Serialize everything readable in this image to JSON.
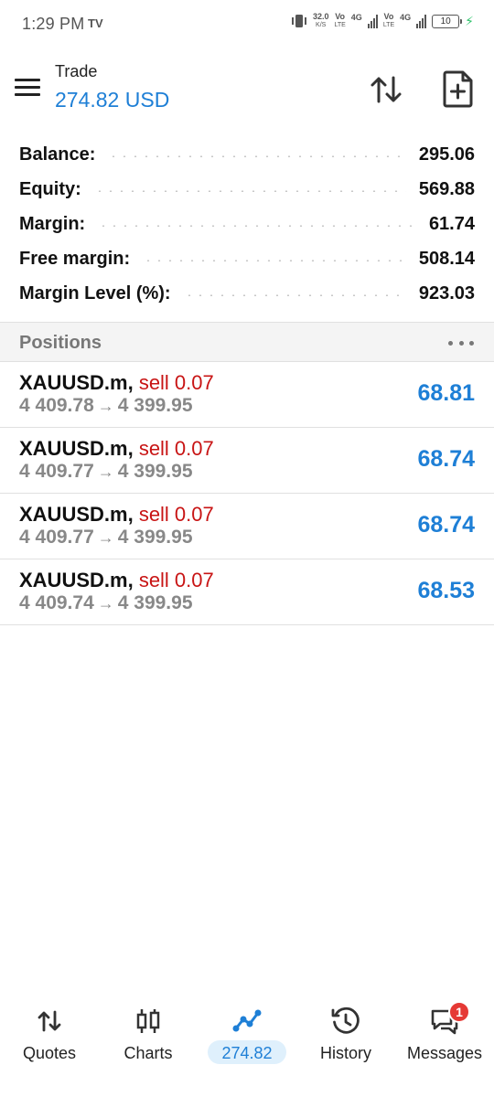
{
  "status_bar": {
    "time": "1:29 PM",
    "app_icon": "TV",
    "data_speed": "32.0",
    "data_speed_unit": "K/S",
    "sim1_label": "Vo",
    "sim1_sub": "LTE",
    "sim1_net": "4G",
    "sim2_label": "Vo",
    "sim2_sub": "LTE",
    "sim2_net": "4G",
    "battery": "10"
  },
  "header": {
    "title": "Trade",
    "subtitle": "274.82 USD",
    "menu_icon": "hamburger-menu-icon",
    "sort_icon": "sort-arrows-icon",
    "new_order_icon": "new-document-icon"
  },
  "summary": [
    {
      "label": "Balance:",
      "value": "295.06"
    },
    {
      "label": "Equity:",
      "value": "569.88"
    },
    {
      "label": "Margin:",
      "value": "61.74"
    },
    {
      "label": "Free margin:",
      "value": "508.14"
    },
    {
      "label": "Margin Level (%):",
      "value": "923.03"
    }
  ],
  "positions": {
    "header": "Positions",
    "items": [
      {
        "symbol": "XAUUSD.m,",
        "side": "sell 0.07",
        "open_price": "4 409.78",
        "arrow": "→",
        "current_price": "4 399.95",
        "profit": "68.81"
      },
      {
        "symbol": "XAUUSD.m,",
        "side": "sell 0.07",
        "open_price": "4 409.77",
        "arrow": "→",
        "current_price": "4 399.95",
        "profit": "68.74"
      },
      {
        "symbol": "XAUUSD.m,",
        "side": "sell 0.07",
        "open_price": "4 409.77",
        "arrow": "→",
        "current_price": "4 399.95",
        "profit": "68.74"
      },
      {
        "symbol": "XAUUSD.m,",
        "side": "sell 0.07",
        "open_price": "4 409.74",
        "arrow": "→",
        "current_price": "4 399.95",
        "profit": "68.53"
      }
    ]
  },
  "bottom_nav": {
    "items": [
      {
        "label": "Quotes",
        "icon": "quotes-arrows-icon"
      },
      {
        "label": "Charts",
        "icon": "candlestick-icon"
      },
      {
        "label": "274.82",
        "icon": "trade-line-icon",
        "active": true
      },
      {
        "label": "History",
        "icon": "history-clock-icon"
      },
      {
        "label": "Messages",
        "icon": "messages-icon",
        "badge": "1"
      }
    ]
  },
  "colors": {
    "accent": "#1e7fd6",
    "sell": "#c81414",
    "badge": "#e53935"
  }
}
